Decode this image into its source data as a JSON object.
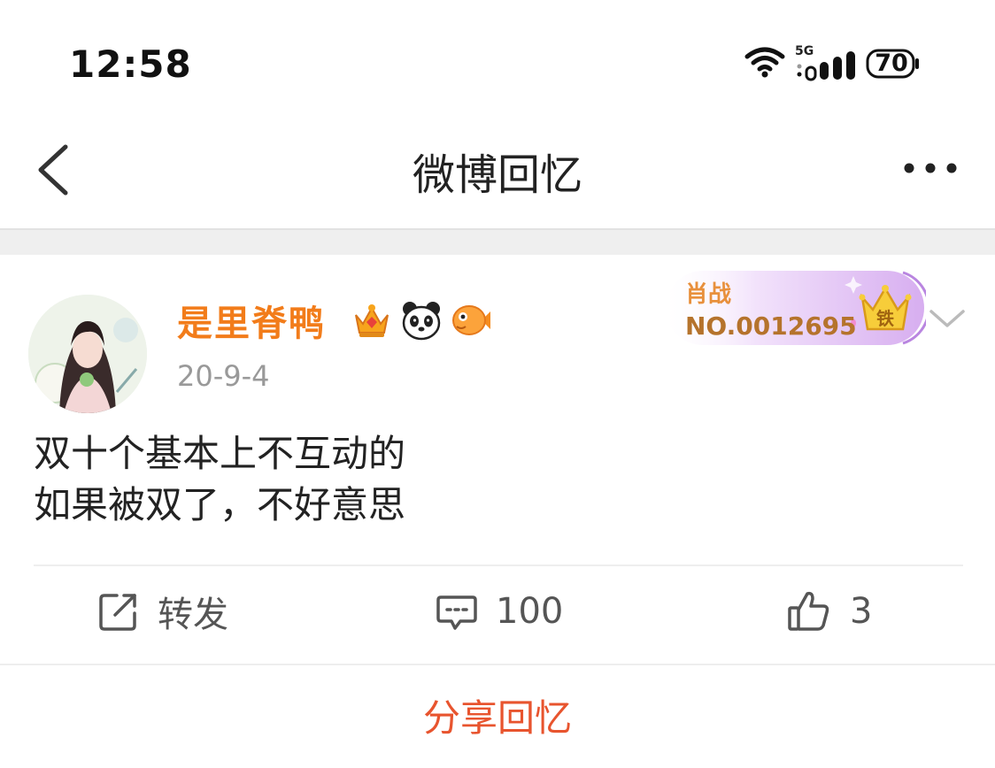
{
  "status_bar": {
    "time": "12:58",
    "network": "5G",
    "battery": "70",
    "icons": [
      "wifi-icon",
      "cellular-signal-icon",
      "battery-icon"
    ]
  },
  "nav": {
    "title": "微博回忆",
    "back_icon": "chevron-left-icon",
    "more_icon": "more-dots-icon"
  },
  "post": {
    "username": "是里脊鸭",
    "badges": [
      "crown-vip-icon",
      "panda-icon",
      "fish-icon"
    ],
    "time": "20-9-4",
    "fan_card": {
      "name": "肖战",
      "number": "NO.0012695",
      "crown_text": "铁"
    },
    "text_lines": [
      "双十个基本上不互动的",
      "如果被双了，不好意思"
    ],
    "actions": {
      "repost_label": "转发",
      "comment_count": "100",
      "like_count": "3"
    }
  },
  "share": {
    "label": "分享回忆"
  },
  "colors": {
    "username": "#f27c1a",
    "share": "#e8542e",
    "fan_card_bg": "#e9d2f5",
    "crown": "#f5c531"
  }
}
